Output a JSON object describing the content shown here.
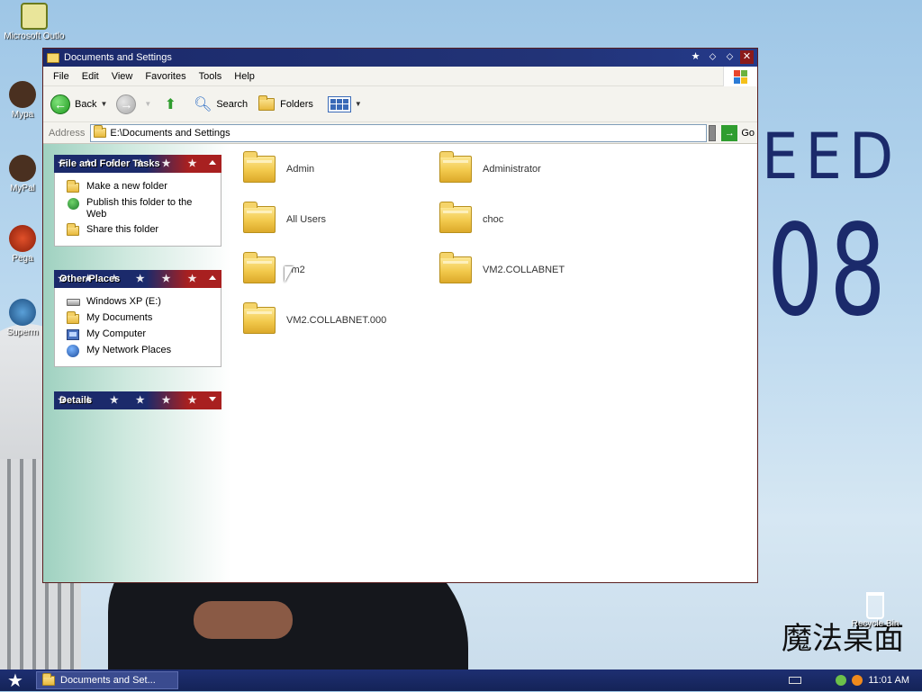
{
  "desktop": {
    "icons": [
      {
        "label": "Microsoft Outlo",
        "icon": "outlook-icon"
      },
      {
        "label": "Mypa",
        "icon": "shortcut-icon"
      },
      {
        "label": "MyPal",
        "icon": "shortcut-icon"
      },
      {
        "label": "Pega",
        "icon": "shortcut-icon"
      },
      {
        "label": "Superm",
        "icon": "shortcut-icon"
      }
    ],
    "recycle_bin": "Recycle Bin",
    "wallpaper_text_1": "EED",
    "wallpaper_text_2": "08",
    "wallpaper_logo": "魔法桌面"
  },
  "window": {
    "title": "Documents and Settings",
    "menu": [
      "File",
      "Edit",
      "View",
      "Favorites",
      "Tools",
      "Help"
    ],
    "toolbar": {
      "back": "Back",
      "search": "Search",
      "folders": "Folders"
    },
    "address": {
      "label": "Address",
      "value": "E:\\Documents and Settings",
      "go": "Go"
    },
    "tasks": {
      "file_folder": {
        "title": "File and Folder Tasks",
        "items": [
          "Make a new folder",
          "Publish this folder to the Web",
          "Share this folder"
        ]
      },
      "other_places": {
        "title": "Other Places",
        "items": [
          "Windows XP (E:)",
          "My Documents",
          "My Computer",
          "My Network Places"
        ]
      },
      "details": {
        "title": "Details"
      }
    },
    "folders": [
      "Admin",
      "Administrator",
      "All Users",
      "choc",
      "vm2",
      "VM2.COLLABNET",
      "VM2.COLLABNET.000"
    ]
  },
  "taskbar": {
    "task": "Documents and Set...",
    "clock": "11:01 AM"
  },
  "colors": {
    "title_blue": "#1b2a6b",
    "panel_red": "#a82020"
  }
}
